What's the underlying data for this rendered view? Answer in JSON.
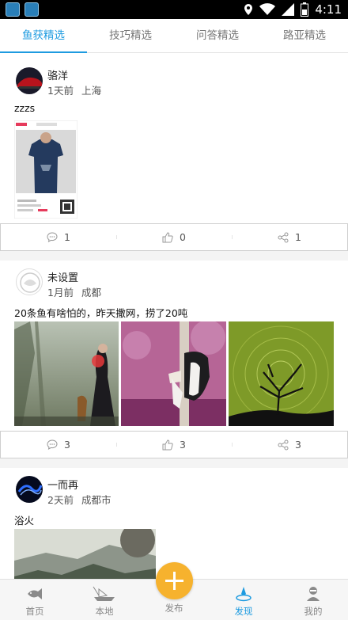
{
  "status_bar": {
    "time": "4:11",
    "icons": [
      "location-icon",
      "wifi-icon",
      "signal-icon",
      "battery-icon"
    ]
  },
  "tabs": [
    {
      "label": "鱼获精选",
      "active": true
    },
    {
      "label": "技巧精选",
      "active": false
    },
    {
      "label": "问答精选",
      "active": false
    },
    {
      "label": "路亚精选",
      "active": false
    }
  ],
  "posts": [
    {
      "user": "骆洋",
      "time_ago": "1天前",
      "location": "上海",
      "text": "zzzs",
      "comments": "1",
      "likes": "0",
      "shares": "1"
    },
    {
      "user": "未设置",
      "time_ago": "1月前",
      "location": "成都",
      "text": "20条鱼有啥怕的，昨天撒网，捞了20吨",
      "comments": "3",
      "likes": "3",
      "shares": "3"
    },
    {
      "user": "一而再",
      "time_ago": "2天前",
      "location": "成都市",
      "text": "浴火"
    }
  ],
  "bottom_nav": [
    {
      "label": "首页",
      "icon": "fish-icon"
    },
    {
      "label": "本地",
      "icon": "boat-icon"
    },
    {
      "label": "发布",
      "icon": "plus-icon"
    },
    {
      "label": "发现",
      "icon": "discover-icon",
      "active": true
    },
    {
      "label": "我的",
      "icon": "profile-icon"
    }
  ],
  "colors": {
    "accent": "#1e9be0",
    "fab": "#f6b22e"
  }
}
